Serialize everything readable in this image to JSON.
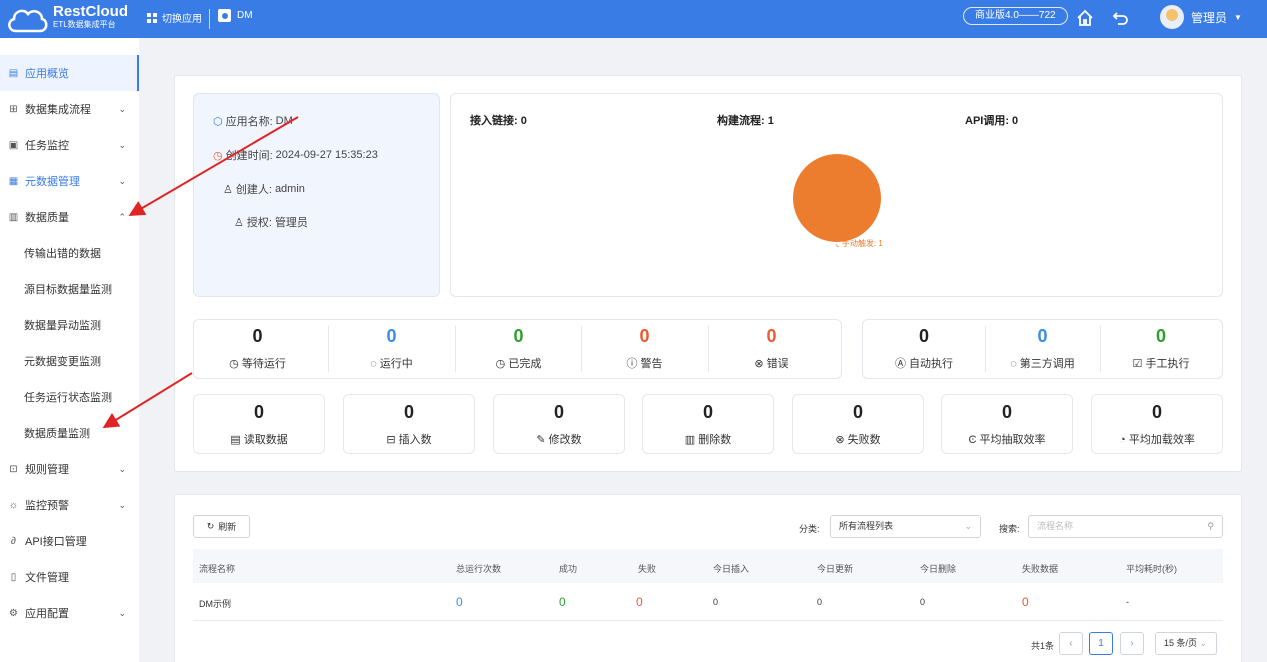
{
  "header": {
    "logo_name": "RestCloud",
    "logo_sub": "ETL数据集成平台",
    "switch_app": "切换应用",
    "current_app": "DM",
    "version": "商业版4.0——722",
    "user": "管理员",
    "color": "#3a7ce6"
  },
  "sidebar": {
    "items": [
      {
        "label": "应用概览",
        "icon": "dashboard-icon",
        "active": true
      },
      {
        "label": "数据集成流程",
        "icon": "flow-icon"
      },
      {
        "label": "任务监控",
        "icon": "monitor-icon"
      },
      {
        "label": "元数据管理",
        "icon": "metadata-icon"
      },
      {
        "label": "数据质量",
        "icon": "chart-icon"
      },
      {
        "label": "规则管理",
        "icon": "rule-icon"
      },
      {
        "label": "监控预警",
        "icon": "alarm-icon"
      },
      {
        "label": "API接口管理",
        "icon": "api-icon"
      },
      {
        "label": "文件管理",
        "icon": "file-icon"
      },
      {
        "label": "应用配置",
        "icon": "settings-icon"
      }
    ],
    "sub_items": [
      "传输出错的数据",
      "源目标数据量监测",
      "数据量异动监测",
      "元数据变更监测",
      "任务运行状态监测",
      "数据质量监测"
    ]
  },
  "info": {
    "app_name_label": "应用名称:",
    "app_name": "DM",
    "created_label": "创建时间:",
    "created": "2024-09-27 15:35:23",
    "creator_label": "创建人:",
    "creator": "admin",
    "auth_label": "授权:",
    "auth": "管理员"
  },
  "stats": {
    "access_links": "接入链接: 0",
    "flows_built": "构建流程: 1",
    "api_calls": "API调用: 0",
    "pie_label": "手动触发: 1",
    "pie_color": "#ec7d2f"
  },
  "chart_data": {
    "type": "pie",
    "categories": [
      "手动触发"
    ],
    "values": [
      1
    ]
  },
  "status_counts": [
    {
      "value": "0",
      "label": "等待运行",
      "color": "#222222",
      "icon": "clock-icon"
    },
    {
      "value": "0",
      "label": "运行中",
      "color": "#3a8ee6",
      "icon": "loading-icon"
    },
    {
      "value": "0",
      "label": "已完成",
      "color": "#2ea02e",
      "icon": "clock-icon"
    },
    {
      "value": "0",
      "label": "警告",
      "color": "#ec5b2f",
      "icon": "warning-icon"
    },
    {
      "value": "0",
      "label": "错误",
      "color": "#ec5b2f",
      "icon": "error-icon"
    }
  ],
  "exec_counts": [
    {
      "value": "0",
      "label": "自动执行",
      "color": "#222222",
      "icon": "auto-icon"
    },
    {
      "value": "0",
      "label": "第三方调用",
      "color": "#3a8ee6",
      "icon": "third-party-icon"
    },
    {
      "value": "0",
      "label": "手工执行",
      "color": "#2ea02e",
      "icon": "edit-icon"
    }
  ],
  "metrics": [
    {
      "value": "0",
      "label": "读取数据",
      "icon": "read-icon"
    },
    {
      "value": "0",
      "label": "插入数",
      "icon": "insert-icon"
    },
    {
      "value": "0",
      "label": "修改数",
      "icon": "modify-icon"
    },
    {
      "value": "0",
      "label": "删除数",
      "icon": "delete-icon"
    },
    {
      "value": "0",
      "label": "失败数",
      "icon": "fail-icon"
    },
    {
      "value": "0",
      "label": "平均抽取效率",
      "icon": "extract-icon"
    },
    {
      "value": "0",
      "label": "平均加载效率",
      "icon": "load-icon"
    }
  ],
  "table": {
    "refresh": "刷新",
    "category_label": "分类:",
    "category_value": "所有流程列表",
    "search_label": "搜索:",
    "search_placeholder": "流程名称",
    "headers": [
      "流程名称",
      "总运行次数",
      "成功",
      "失败",
      "今日插入",
      "今日更新",
      "今日删除",
      "失败数据",
      "平均耗时(秒)"
    ],
    "rows": [
      [
        "DM示例",
        "0",
        "0",
        "0",
        "0",
        "0",
        "0",
        "0",
        "-"
      ]
    ],
    "total": "共1条",
    "page": "1",
    "page_size": "15 条/页"
  }
}
